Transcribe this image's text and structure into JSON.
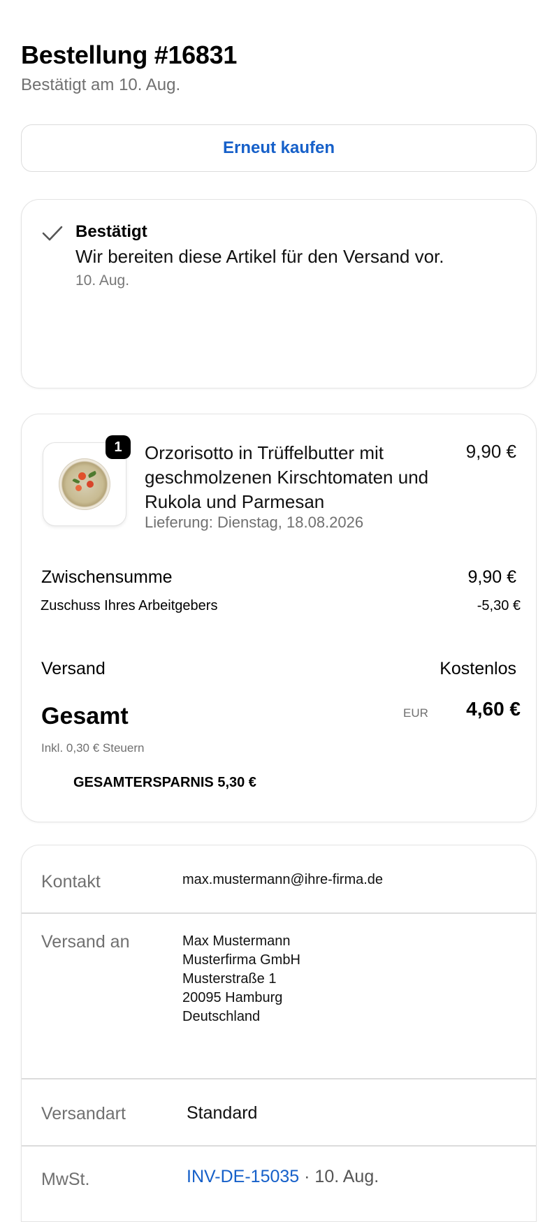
{
  "header": {
    "title": "Bestellung #16831",
    "subtitle": "Bestätigt am 10. Aug."
  },
  "actions": {
    "buy_again_label": "Erneut kaufen"
  },
  "status": {
    "icon": "checkmark-icon",
    "title": "Bestätigt",
    "description": "Wir bereiten diese Artikel für den Versand vor.",
    "date": "10. Aug."
  },
  "order": {
    "item": {
      "quantity": "1",
      "name": "Orzorisotto in Trüffelbutter mit geschmolzenen Kirschtomaten und Rukola und Parmesan",
      "delivery": "Lieferung: Dienstag, 18.08.2026",
      "price": "9,90 €"
    },
    "subtotal_label": "Zwischensumme",
    "subtotal_value": "9,90 €",
    "subsidy_label": "Zuschuss Ihres Arbeitgebers",
    "subsidy_value": "-5,30 €",
    "shipping_label": "Versand",
    "shipping_value": "Kostenlos",
    "total_label": "Gesamt",
    "currency": "EUR",
    "total_value": "4,60 €",
    "tax_note": "Inkl. 0,30 € Steuern",
    "savings": "GESAMTERSPARNIS 5,30 €"
  },
  "info": {
    "contact_label": "Kontakt",
    "contact_value": "max.mustermann@ihre-firma.de",
    "ship_to_label": "Versand an",
    "address": [
      "Max Mustermann",
      "Musterfirma GmbH",
      "Musterstraße 1",
      "20095 Hamburg",
      "Deutschland"
    ],
    "shipping_method_label": "Versandart",
    "shipping_method_value": "Standard",
    "vat_label": "MwSt.",
    "invoice_number": "INV-DE-15035",
    "invoice_date": " · 10. Aug."
  },
  "colors": {
    "accent": "#1660c9",
    "muted_text": "#707070",
    "border": "#dcdcdc"
  }
}
